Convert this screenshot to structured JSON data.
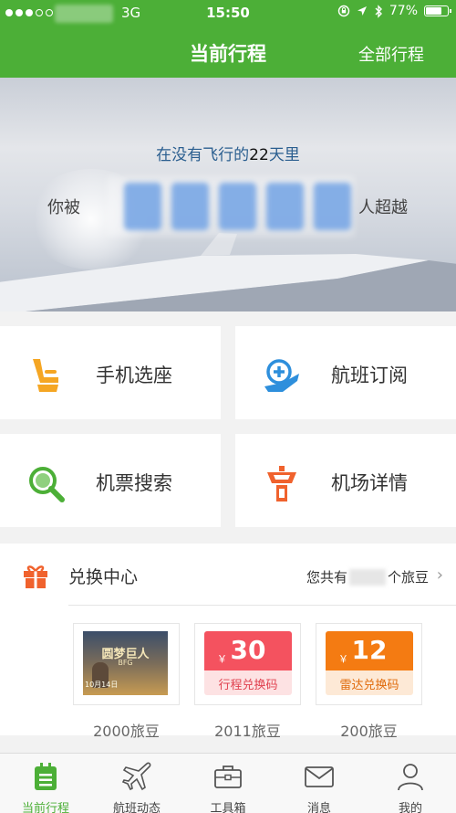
{
  "status_bar": {
    "network": "3G",
    "time": "15:50",
    "battery": "77%"
  },
  "nav": {
    "title": "当前行程",
    "right_action": "全部行程"
  },
  "hero": {
    "line1_prefix": "在没有飞行的",
    "days": "22",
    "line1_suffix": "天里",
    "line2_prefix": "你被",
    "line2_suffix": "人超越"
  },
  "actions": [
    {
      "label": "手机选座",
      "icon": "seat-icon"
    },
    {
      "label": "航班订阅",
      "icon": "flight-subscribe-icon"
    },
    {
      "label": "机票搜索",
      "icon": "search-icon"
    },
    {
      "label": "机场详情",
      "icon": "airport-tower-icon"
    }
  ],
  "exchange": {
    "title": "兑换中心",
    "beans_prefix": "您共有",
    "beans_suffix": "个旅豆",
    "items": [
      {
        "type": "poster",
        "poster_title": "圆梦巨人",
        "poster_sub": "BFG",
        "poster_date": "10月14日",
        "price": "2000旅豆"
      },
      {
        "type": "voucher",
        "currency": "￥",
        "amount": "30",
        "caption": "行程兑换码",
        "price": "2011旅豆",
        "color_top": "#f4525f",
        "color_bottom": "#fde2e3",
        "caption_color": "#e0414f"
      },
      {
        "type": "voucher",
        "currency": "￥",
        "amount": "12",
        "caption": "雷达兑换码",
        "price": "200旅豆",
        "color_top": "#f47b12",
        "color_bottom": "#fde9d6",
        "caption_color": "#e06a0a"
      }
    ]
  },
  "tabs": [
    {
      "label": "当前行程",
      "icon": "itinerary-icon",
      "active": true
    },
    {
      "label": "航班动态",
      "icon": "airplane-icon",
      "active": false
    },
    {
      "label": "工具箱",
      "icon": "toolbox-icon",
      "active": false
    },
    {
      "label": "消息",
      "icon": "message-icon",
      "active": false
    },
    {
      "label": "我的",
      "icon": "profile-icon",
      "active": false
    }
  ],
  "colors": {
    "brand_green": "#4caf37",
    "orange": "#f5a623",
    "red_orange": "#f0622d"
  }
}
